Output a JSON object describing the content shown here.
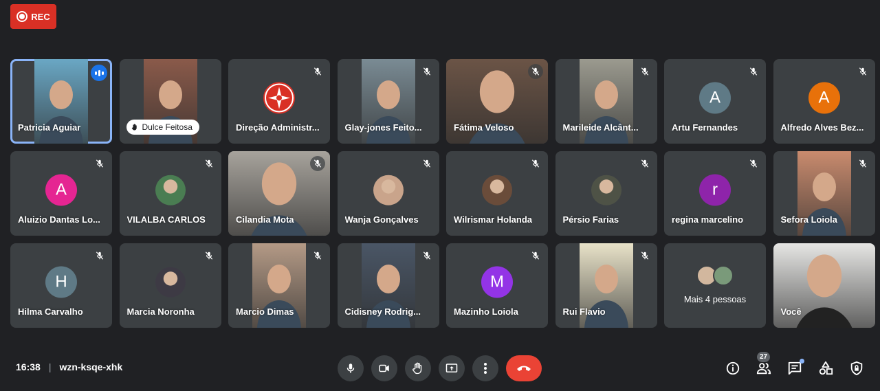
{
  "recording": {
    "label": "REC"
  },
  "tiles": [
    {
      "name": "Patricia Aguiar",
      "kind": "video",
      "bg": "#6aa7c4",
      "speaking": true
    },
    {
      "name": "Dulce Feitosa",
      "kind": "video-pill",
      "bg": "#8a5a4a"
    },
    {
      "name": "Direção Administr...",
      "kind": "logo"
    },
    {
      "name": "Glay-jones Feito...",
      "kind": "video",
      "bg": "#7a8b94"
    },
    {
      "name": "Fátima Veloso",
      "kind": "video-wide",
      "bg": "#6b5446"
    },
    {
      "name": "Marileide Alcânt...",
      "kind": "video",
      "bg": "#9b9a8f"
    },
    {
      "name": "Artu Fernandes",
      "kind": "letter",
      "letter": "A",
      "color": "#5f7a86"
    },
    {
      "name": "Alfredo Alves Bez...",
      "kind": "letter",
      "letter": "A",
      "color": "#e8710a"
    },
    {
      "name": "Aluizio Dantas Lo...",
      "kind": "letter",
      "letter": "A",
      "color": "#e52592"
    },
    {
      "name": "VILALBA CARLOS",
      "kind": "photo",
      "color": "#4a7d52"
    },
    {
      "name": "Cilandia Mota",
      "kind": "video-wide",
      "bg": "#a7a39c"
    },
    {
      "name": "Wanja Gonçalves",
      "kind": "photo",
      "color": "#c9a48b"
    },
    {
      "name": "Wilrismar Holanda",
      "kind": "photo",
      "color": "#6a4c3a"
    },
    {
      "name": "Pérsio Farias",
      "kind": "photo",
      "color": "#4e5246"
    },
    {
      "name": "regina marcelino",
      "kind": "letter",
      "letter": "r",
      "color": "#8e24aa"
    },
    {
      "name": "Sefora Loiola",
      "kind": "video",
      "bg": "#c98b6e"
    },
    {
      "name": "Hilma Carvalho",
      "kind": "letter",
      "letter": "H",
      "color": "#5f7a86"
    },
    {
      "name": "Marcia Noronha",
      "kind": "photo",
      "color": "#3d3a44"
    },
    {
      "name": "Marcio Dimas",
      "kind": "video",
      "bg": "#b49a86"
    },
    {
      "name": "Cidisney Rodrig...",
      "kind": "video",
      "bg": "#4a5666"
    },
    {
      "name": "Mazinho Loiola",
      "kind": "letter",
      "letter": "M",
      "color": "#9334e6"
    },
    {
      "name": "Rui Flavio",
      "kind": "video",
      "bg": "#e8e2c8"
    },
    {
      "name": "Mais 4 pessoas",
      "kind": "more"
    },
    {
      "name": "Você",
      "kind": "video-wide-self",
      "bg": "#e6e6e4"
    }
  ],
  "meeting": {
    "time": "16:38",
    "separator": "|",
    "code": "wzn-ksqe-xhk"
  },
  "controls": [
    "mic-icon",
    "camera-icon",
    "raise-hand-icon",
    "present-icon",
    "more-options-icon",
    "leave-call-icon"
  ],
  "right_icons": {
    "participants_count": "27"
  }
}
